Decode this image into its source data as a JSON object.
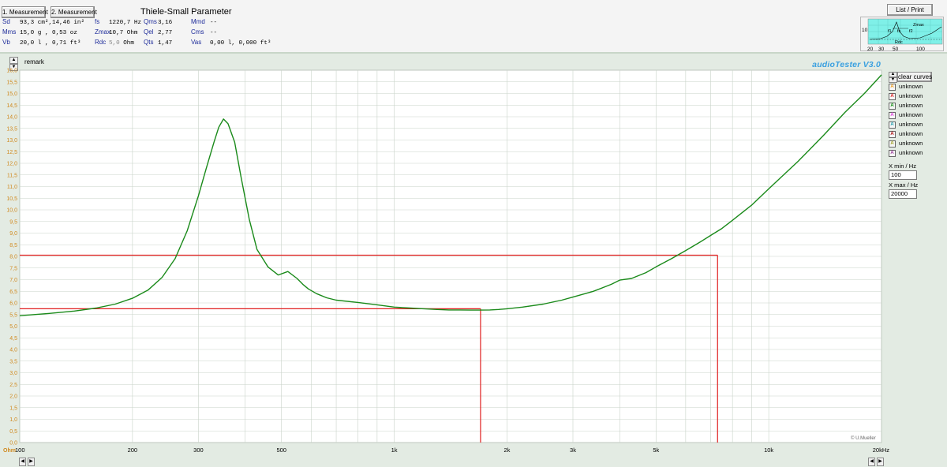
{
  "header": {
    "meas1_label": "1. Measurement",
    "meas2_label": "2. Measurement",
    "ts_title": "Thiele-Small Parameter",
    "list_print_label": "List / Print"
  },
  "ts_params": {
    "col1": [
      {
        "label": "Sd",
        "value": "93,3 cm²,14,46 in²"
      },
      {
        "label": "Mms",
        "value": "15,0 g  , 0,53 oz"
      },
      {
        "label": "Vb",
        "value": "20,0 l   , 0,71 ft³"
      }
    ],
    "col2": [
      {
        "label": "fs",
        "value": "1220,7 Hz"
      },
      {
        "label": "Zmax",
        "value": "10,7 Ohm"
      },
      {
        "label": "Rdc",
        "value": "5,0",
        "unit": "Ohm"
      }
    ],
    "col3": [
      {
        "label": "Qms",
        "value": "3,16"
      },
      {
        "label": "Qel",
        "value": "2,77"
      },
      {
        "label": "Qts",
        "value": "1,47"
      }
    ],
    "col4": [
      {
        "label": "Mmd",
        "value": "--"
      },
      {
        "label": "Cms",
        "value": "--"
      },
      {
        "label": "Vas",
        "value": "0,00 l, 0,000 ft³"
      }
    ]
  },
  "mini_chart": {
    "y_tick": "10",
    "labels": [
      "f1",
      "fs",
      "f2",
      "Zmax",
      "Rdc"
    ],
    "x_ticks": [
      "20",
      "30",
      "50",
      "100"
    ]
  },
  "remark_label": "remark",
  "brand": "audioTester  V3.0",
  "credit": "© U.Mueller",
  "legend": {
    "clear_label": "clear curves",
    "items": [
      {
        "letter": "A",
        "name": "unknown",
        "color": "#f0a020"
      },
      {
        "letter": "A",
        "name": "unknown",
        "color": "#e02020"
      },
      {
        "letter": "A",
        "name": "unknown",
        "color": "#109010"
      },
      {
        "letter": "A",
        "name": "unknown",
        "color": "#e040e0"
      },
      {
        "letter": "A",
        "name": "unknown",
        "color": "#20a0b0"
      },
      {
        "letter": "A",
        "name": "unknown",
        "color": "#b01010"
      },
      {
        "letter": "A",
        "name": "unknown",
        "color": "#a0a020"
      },
      {
        "letter": "A",
        "name": "unknown",
        "color": "#a040a0"
      }
    ]
  },
  "xrange": {
    "min_label": "X min / Hz",
    "min_value": "100",
    "max_label": "X max / Hz",
    "max_value": "20000"
  },
  "chart_data": {
    "type": "line",
    "unit_label": "Ohm",
    "x_scale": "log",
    "xlim": [
      100,
      20000
    ],
    "ylim": [
      0,
      16
    ],
    "grid": true,
    "x_ticks": [
      {
        "value": 100,
        "label": "100"
      },
      {
        "value": 200,
        "label": "200"
      },
      {
        "value": 300,
        "label": "300"
      },
      {
        "value": 500,
        "label": "500"
      },
      {
        "value": 1000,
        "label": "1k"
      },
      {
        "value": 2000,
        "label": "2k"
      },
      {
        "value": 3000,
        "label": "3k"
      },
      {
        "value": 5000,
        "label": "5k"
      },
      {
        "value": 10000,
        "label": "10k"
      },
      {
        "value": 20000,
        "label": "20kHz"
      }
    ],
    "y_ticks": [
      "0,0",
      "0,5",
      "1,0",
      "1,5",
      "2,0",
      "2,5",
      "3,0",
      "3,5",
      "4,0",
      "4,5",
      "5,0",
      "5,5",
      "6,0",
      "6,5",
      "7,0",
      "7,5",
      "8,0",
      "8,5",
      "9,0",
      "9,5",
      "10,0",
      "10,5",
      "11,0",
      "11,5",
      "12,0",
      "12,5",
      "13,0",
      "13,5",
      "14,0",
      "14,5",
      "15,0",
      "15,5",
      "16,0"
    ],
    "series": [
      {
        "color": "#1a8a1a",
        "x": [
          100,
          120,
          140,
          160,
          180,
          200,
          220,
          240,
          260,
          280,
          300,
          315,
          330,
          340,
          350,
          360,
          375,
          390,
          410,
          430,
          460,
          490,
          520,
          550,
          570,
          590,
          620,
          660,
          700,
          800,
          900,
          1000,
          1100,
          1200,
          1300,
          1400,
          1500,
          1600,
          1700,
          1800,
          1900,
          2000,
          2200,
          2500,
          2800,
          3000,
          3400,
          3800,
          4000,
          4300,
          4700,
          5000,
          5500,
          6000,
          6500,
          7000,
          7500,
          8000,
          9000,
          10000,
          12000,
          14000,
          16000,
          18000,
          20000
        ],
        "y": [
          5.45,
          5.55,
          5.65,
          5.78,
          5.95,
          6.2,
          6.55,
          7.1,
          7.9,
          9.1,
          10.6,
          11.8,
          12.9,
          13.55,
          13.9,
          13.7,
          12.9,
          11.4,
          9.6,
          8.3,
          7.55,
          7.2,
          7.35,
          7.05,
          6.8,
          6.6,
          6.4,
          6.22,
          6.12,
          6.02,
          5.92,
          5.82,
          5.78,
          5.75,
          5.72,
          5.7,
          5.7,
          5.69,
          5.69,
          5.7,
          5.72,
          5.75,
          5.82,
          5.95,
          6.12,
          6.25,
          6.5,
          6.8,
          6.98,
          7.05,
          7.3,
          7.55,
          7.9,
          8.25,
          8.58,
          8.9,
          9.2,
          9.55,
          10.2,
          10.9,
          12.1,
          13.2,
          14.2,
          15.0,
          15.8
        ]
      }
    ],
    "markers": [
      {
        "color": "#e02020",
        "y": 5.75,
        "x_end": 1700
      },
      {
        "color": "#e02020",
        "y": 8.05,
        "x_end": 7300
      }
    ]
  },
  "icons": {
    "left": "left-arrow-icon",
    "right": "right-arrow-icon",
    "up": "up-arrow-icon",
    "down": "down-arrow-icon"
  }
}
